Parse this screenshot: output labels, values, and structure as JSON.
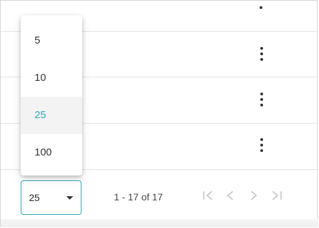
{
  "paginator": {
    "page_size": {
      "selected": "25",
      "options": [
        "5",
        "10",
        "25",
        "100"
      ]
    },
    "range_label": "1 - 17 of 17",
    "nav_icons": [
      "first-page-icon",
      "prev-page-icon",
      "next-page-icon",
      "last-page-icon"
    ]
  },
  "colors": {
    "accent": "#2aa7b5",
    "selected_option_bg": "#f3f3f3",
    "disabled_icon": "#c4c4c4"
  }
}
